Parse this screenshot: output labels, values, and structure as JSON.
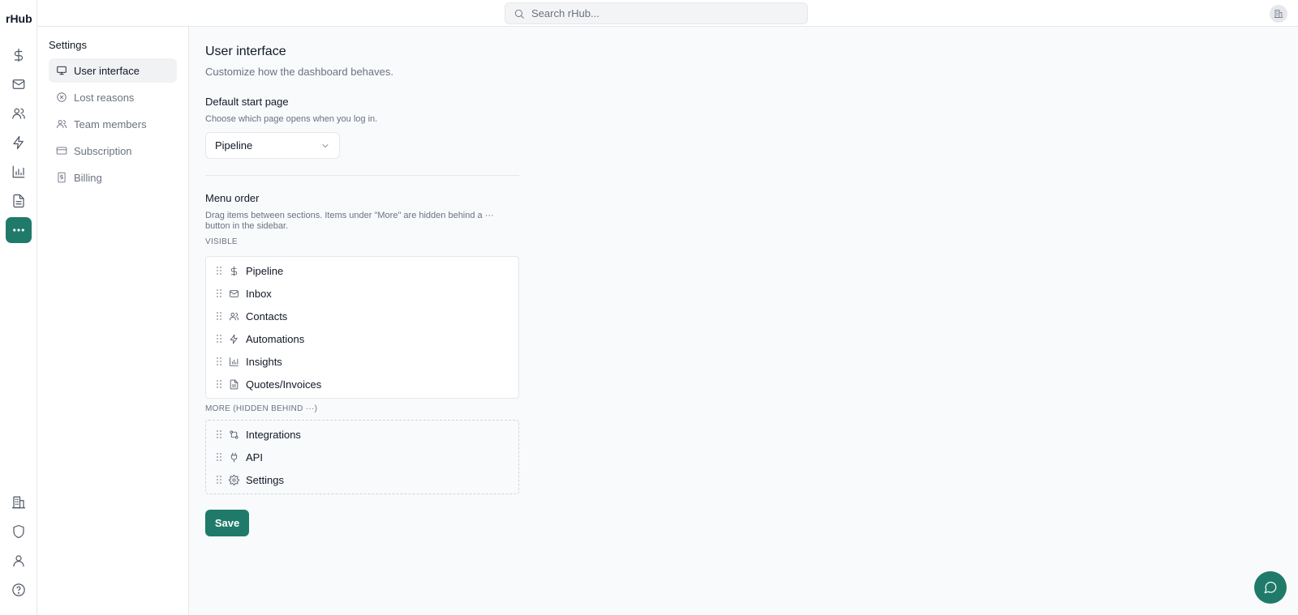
{
  "app": {
    "brand": "rHub"
  },
  "search": {
    "placeholder": "Search rHub..."
  },
  "rail": {
    "top": [
      "dollar-icon",
      "mail-icon",
      "users-icon",
      "zap-icon",
      "chart-icon",
      "file-icon",
      "more-icon"
    ],
    "bottom": [
      "building-icon",
      "shield-icon",
      "user-icon",
      "help-icon"
    ],
    "active": "more-icon"
  },
  "settings": {
    "title": "Settings",
    "items": [
      {
        "label": "User interface",
        "icon": "monitor-icon",
        "active": true
      },
      {
        "label": "Lost reasons",
        "icon": "x-circle-icon"
      },
      {
        "label": "Team members",
        "icon": "users-icon"
      },
      {
        "label": "Subscription",
        "icon": "credit-card-icon"
      },
      {
        "label": "Billing",
        "icon": "receipt-icon"
      }
    ]
  },
  "main": {
    "title": "User interface",
    "subtitle": "Customize how the dashboard behaves.",
    "start_page": {
      "heading": "Default start page",
      "hint": "Choose which page opens when you log in.",
      "selected": "Pipeline"
    },
    "menu_order": {
      "heading": "Menu order",
      "hint": "Drag items between sections. Items under \"More\" are hidden behind a ··· button in the sidebar.",
      "visible_label": "VISIBLE",
      "visible": [
        {
          "label": "Pipeline",
          "icon": "dollar-icon"
        },
        {
          "label": "Inbox",
          "icon": "mail-icon"
        },
        {
          "label": "Contacts",
          "icon": "users-icon"
        },
        {
          "label": "Automations",
          "icon": "zap-icon"
        },
        {
          "label": "Insights",
          "icon": "chart-icon"
        },
        {
          "label": "Quotes/Invoices",
          "icon": "file-icon"
        }
      ],
      "more_label": "MORE (HIDDEN BEHIND ···)",
      "more": [
        {
          "label": "Integrations",
          "icon": "integrations-icon"
        },
        {
          "label": "API",
          "icon": "plug-icon"
        },
        {
          "label": "Settings",
          "icon": "gear-icon"
        }
      ]
    },
    "save_label": "Save"
  },
  "colors": {
    "accent": "#1f7a69"
  }
}
